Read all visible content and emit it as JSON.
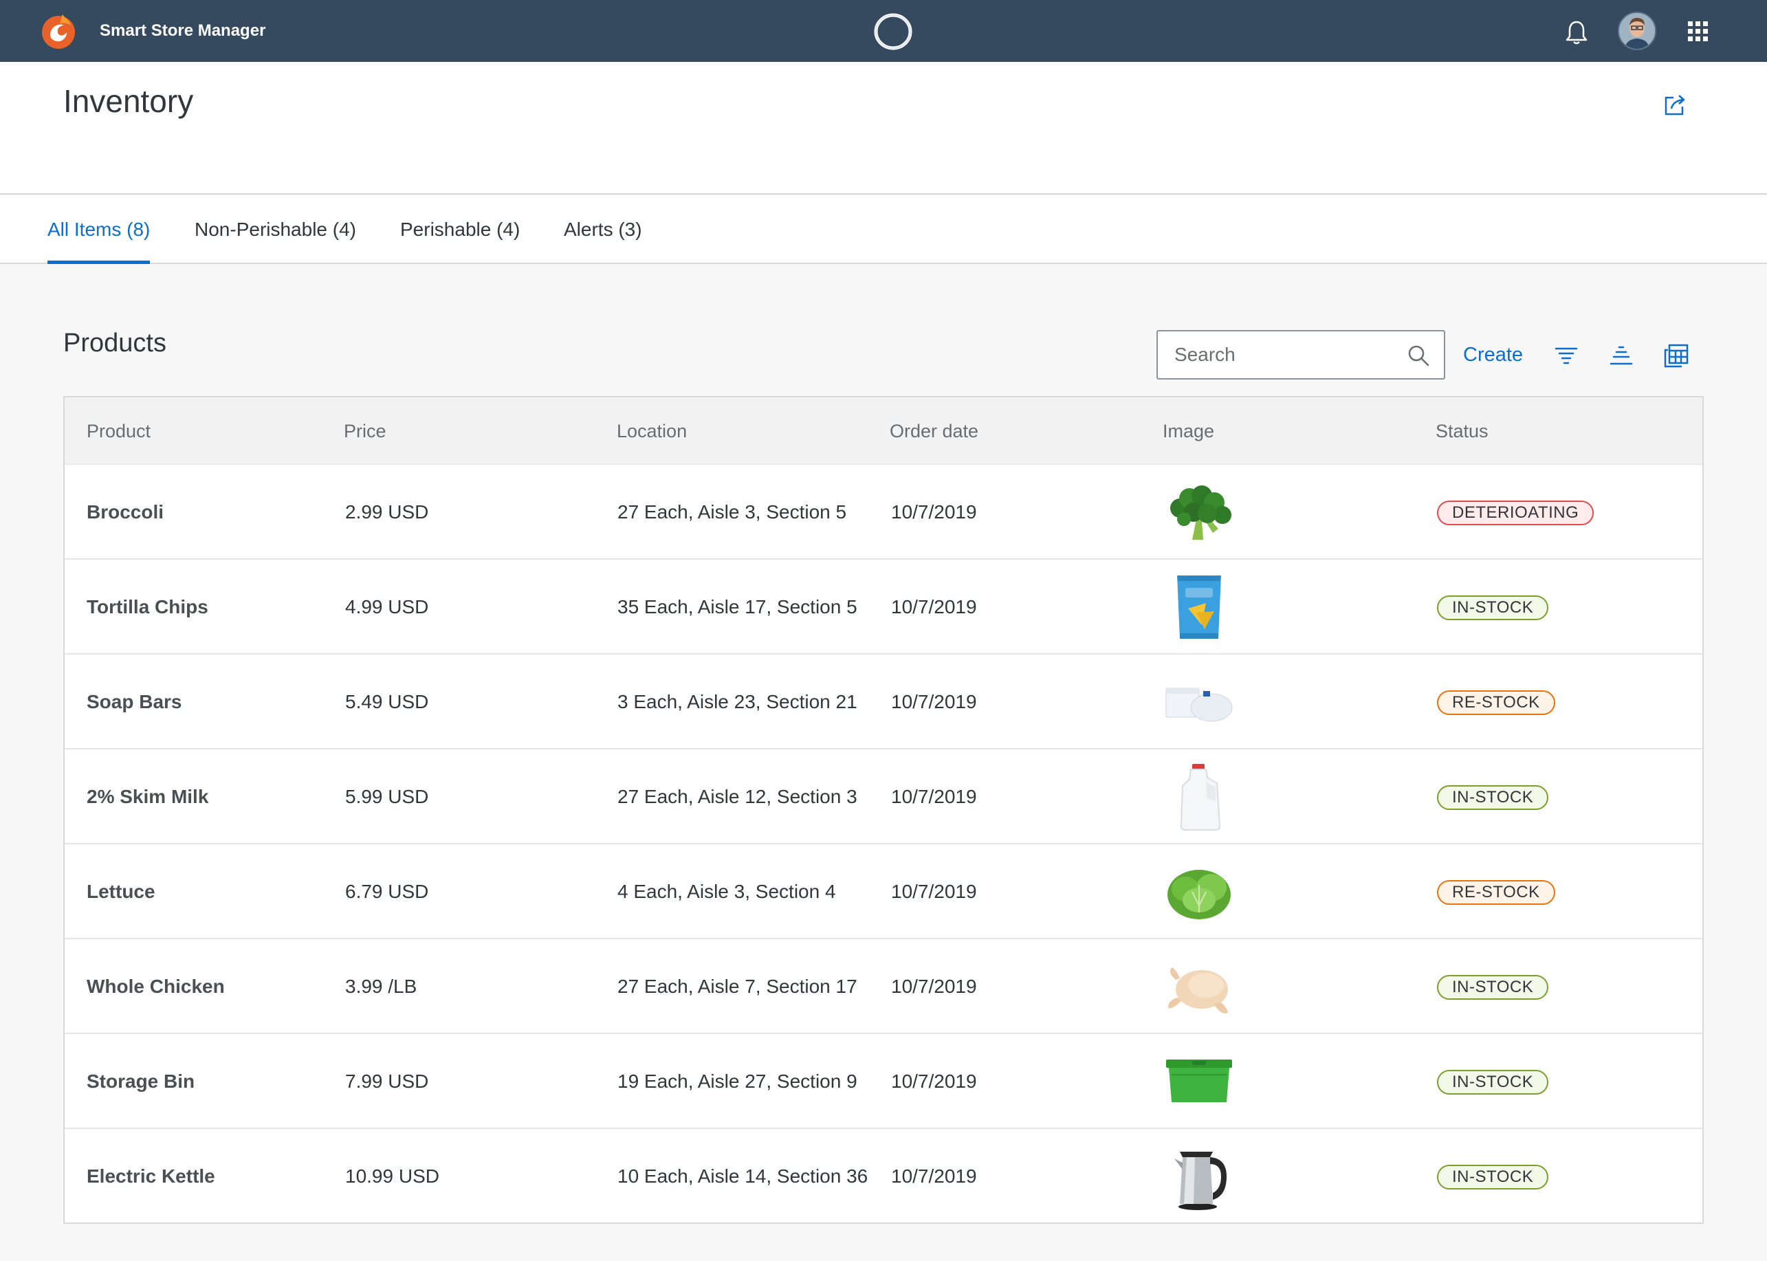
{
  "app": {
    "title": "Smart Store Manager"
  },
  "page": {
    "title": "Inventory"
  },
  "tabs": [
    {
      "label": "All Items (8)",
      "active": true
    },
    {
      "label": "Non-Perishable (4)",
      "active": false
    },
    {
      "label": "Perishable (4)",
      "active": false
    },
    {
      "label": "Alerts (3)",
      "active": false
    }
  ],
  "products_section": {
    "title": "Products",
    "search_placeholder": "Search",
    "create_label": "Create"
  },
  "table": {
    "columns": [
      "Product",
      "Price",
      "Location",
      "Order date",
      "Image",
      "Status"
    ],
    "rows": [
      {
        "product": "Broccoli",
        "price": "2.99 USD",
        "location": "27 Each, Aisle 3, Section 5",
        "order_date": "10/7/2019",
        "image": "broccoli-image",
        "status": "DETERIOATING",
        "status_type": "neg"
      },
      {
        "product": "Tortilla Chips",
        "price": "4.99 USD",
        "location": "35 Each, Aisle 17, Section 5",
        "order_date": "10/7/2019",
        "image": "tortilla-chips-image",
        "status": "IN-STOCK",
        "status_type": "pos"
      },
      {
        "product": "Soap Bars",
        "price": "5.49 USD",
        "location": "3 Each, Aisle 23, Section 21",
        "order_date": "10/7/2019",
        "image": "soap-bars-image",
        "status": "RE-STOCK",
        "status_type": "crit"
      },
      {
        "product": "2% Skim Milk",
        "price": "5.99 USD",
        "location": "27 Each, Aisle 12, Section 3",
        "order_date": "10/7/2019",
        "image": "milk-jug-image",
        "status": "IN-STOCK",
        "status_type": "pos"
      },
      {
        "product": "Lettuce",
        "price": "6.79 USD",
        "location": "4 Each, Aisle 3, Section 4",
        "order_date": "10/7/2019",
        "image": "lettuce-image",
        "status": "RE-STOCK",
        "status_type": "crit"
      },
      {
        "product": "Whole Chicken",
        "price": "3.99 /LB",
        "location": "27 Each, Aisle 7, Section 17",
        "order_date": "10/7/2019",
        "image": "whole-chicken-image",
        "status": "IN-STOCK",
        "status_type": "pos"
      },
      {
        "product": "Storage Bin",
        "price": "7.99 USD",
        "location": "19 Each, Aisle 27, Section 9",
        "order_date": "10/7/2019",
        "image": "storage-bin-image",
        "status": "IN-STOCK",
        "status_type": "pos"
      },
      {
        "product": "Electric Kettle",
        "price": "10.99 USD",
        "location": "10 Each, Aisle 14, Section 36",
        "order_date": "10/7/2019",
        "image": "electric-kettle-image",
        "status": "IN-STOCK",
        "status_type": "pos"
      }
    ]
  },
  "icons": {
    "logo": "app-logo-icon",
    "assistant": "assistant-ring-icon",
    "notifications": "bell-icon",
    "avatar": "user-avatar",
    "app_launcher": "grid-icon",
    "share": "share-icon",
    "search": "search-icon",
    "filter": "filter-icon",
    "sort": "sort-icon",
    "table_settings": "table-settings-icon"
  },
  "colors": {
    "shell": "#354a5f",
    "accent": "#0a6ed1",
    "negative": "#e14b4b",
    "positive": "#7aa02b",
    "critical": "#e9730c"
  }
}
